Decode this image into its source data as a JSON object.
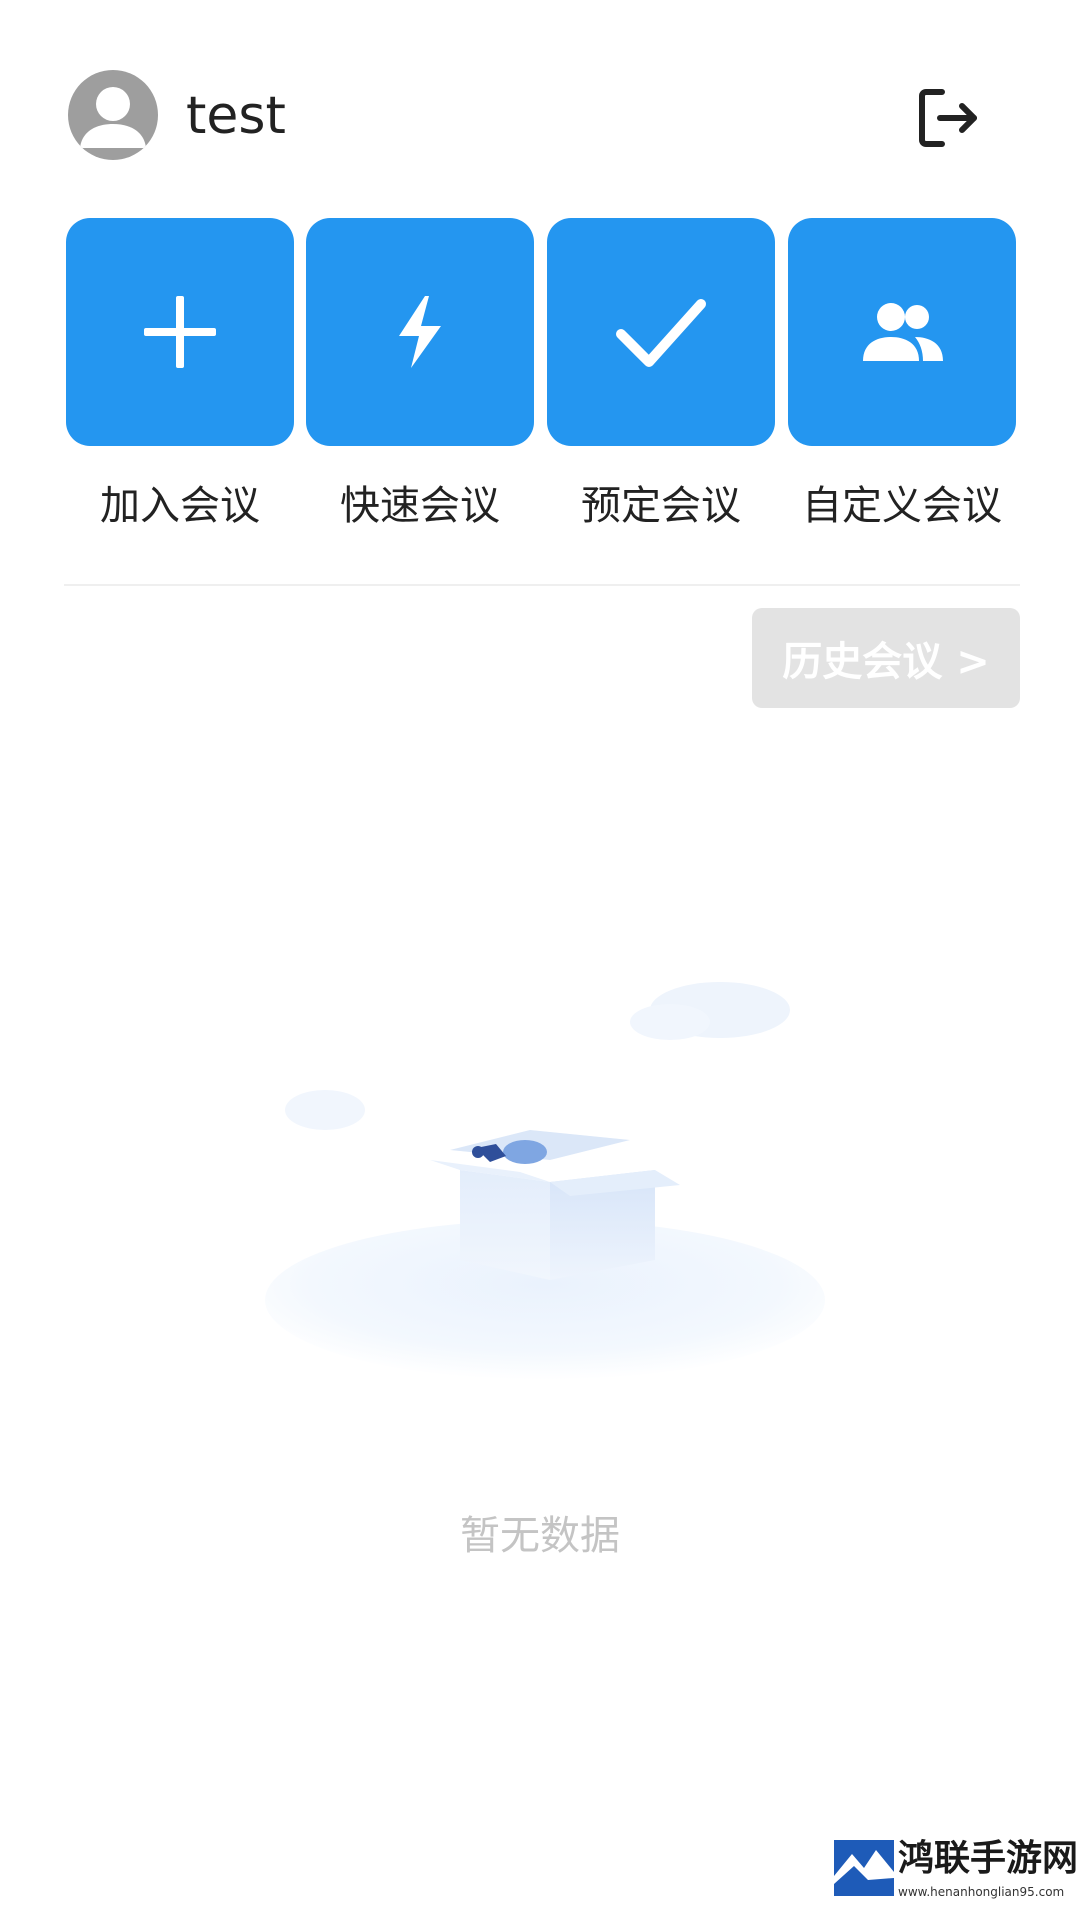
{
  "user": {
    "name": "test"
  },
  "actions": [
    {
      "label": "加入会议",
      "icon": "plus-icon"
    },
    {
      "label": "快速会议",
      "icon": "lightning-icon"
    },
    {
      "label": "预定会议",
      "icon": "checkmark-icon"
    },
    {
      "label": "自定义会议",
      "icon": "people-icon"
    }
  ],
  "history": {
    "label": "历史会议 >"
  },
  "empty_state": {
    "text": "暂无数据"
  },
  "watermark": {
    "title": "鸿联手游网",
    "url": "www.henanhonglian95.com"
  },
  "colors": {
    "accent": "#2496f0",
    "history_button_bg": "#e3e3e3",
    "empty_text": "#c4c4c4",
    "avatar": "#9e9e9e"
  }
}
